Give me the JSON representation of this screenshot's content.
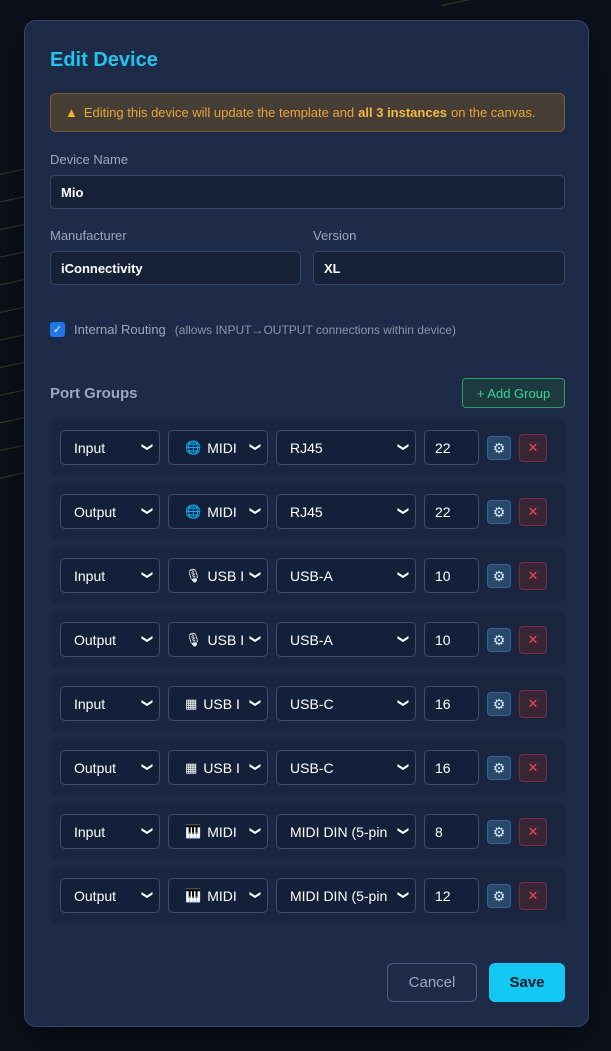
{
  "dialog": {
    "title": "Edit Device",
    "warning": {
      "prefix": "Editing this device will update the template and",
      "bold": "all 3 instances",
      "suffix": "on the canvas."
    },
    "device_name": {
      "label": "Device Name",
      "value": "Mio"
    },
    "manufacturer": {
      "label": "Manufacturer",
      "value": "iConnectivity"
    },
    "version": {
      "label": "Version",
      "value": "XL"
    },
    "internal_routing": {
      "checked": true,
      "label": "Internal Routing",
      "hint": "(allows INPUT→OUTPUT connections within device)"
    },
    "port_groups": {
      "title": "Port Groups",
      "add_label": "+ Add Group",
      "rows": [
        {
          "direction": "Input",
          "type_icon": "globe-icon",
          "type_glyph": "🌐",
          "type": "MIDI",
          "connector": "RJ45",
          "count": "22"
        },
        {
          "direction": "Output",
          "type_icon": "globe-icon",
          "type_glyph": "🌐",
          "type": "MIDI",
          "connector": "RJ45",
          "count": "22"
        },
        {
          "direction": "Input",
          "type_icon": "microphone-icon",
          "type_glyph": "🎙",
          "type": "USB I",
          "connector": "USB-A",
          "count": "10"
        },
        {
          "direction": "Output",
          "type_icon": "microphone-icon",
          "type_glyph": "🎙",
          "type": "USB I",
          "connector": "USB-A",
          "count": "10"
        },
        {
          "direction": "Input",
          "type_icon": "usb-device-icon",
          "type_glyph": "▦",
          "type": "USB I",
          "connector": "USB-C",
          "count": "16"
        },
        {
          "direction": "Output",
          "type_icon": "usb-device-icon",
          "type_glyph": "▦",
          "type": "USB I",
          "connector": "USB-C",
          "count": "16"
        },
        {
          "direction": "Input",
          "type_icon": "piano-icon",
          "type_glyph": "🎹",
          "type": "MIDI",
          "connector": "MIDI DIN (5-pin",
          "count": "8"
        },
        {
          "direction": "Output",
          "type_icon": "piano-icon",
          "type_glyph": "🎹",
          "type": "MIDI",
          "connector": "MIDI DIN (5-pin",
          "count": "12"
        }
      ]
    },
    "cancel_label": "Cancel",
    "save_label": "Save"
  },
  "colors": {
    "accent": "#22c4ee",
    "warning": "#e8a53a",
    "add": "#34d399",
    "danger": "#e5484d"
  }
}
